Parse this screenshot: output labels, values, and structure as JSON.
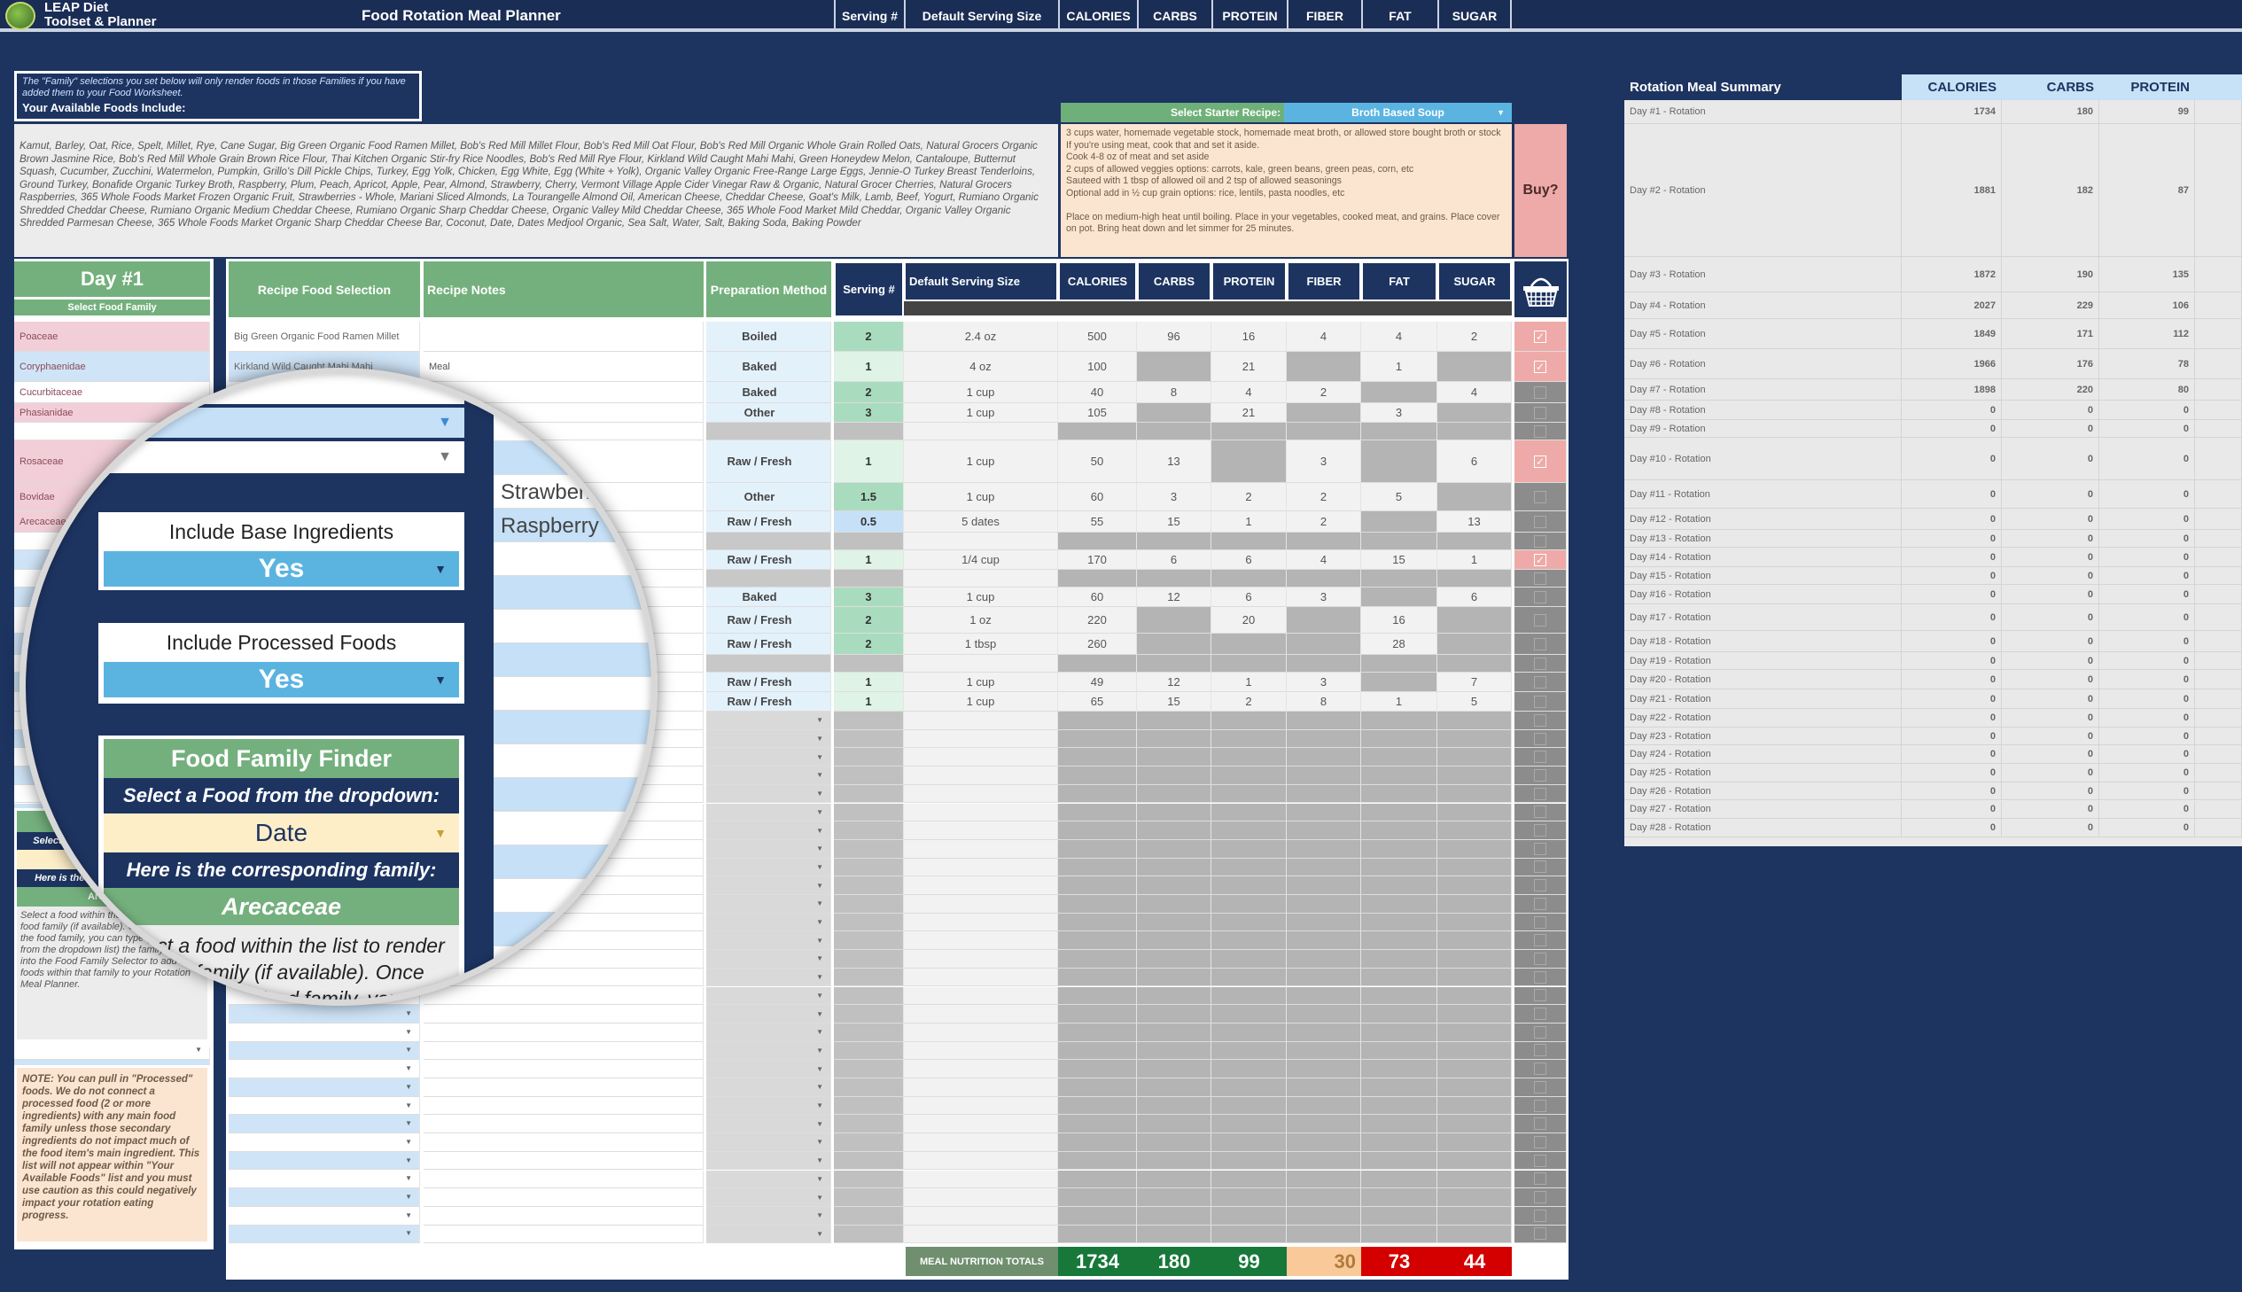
{
  "app": {
    "logo_line1": "LEAP Diet",
    "logo_line2": "Toolset & Planner",
    "title": "Food Rotation Meal Planner"
  },
  "top_columns": [
    "Serving #",
    "Default Serving Size",
    "CALORIES",
    "CARBS",
    "PROTEIN",
    "FIBER",
    "FAT",
    "SUGAR"
  ],
  "info": {
    "note": "The \"Family\" selections you set below will only render foods in those Families if you have added them to your Food Worksheet.",
    "heading": "Your Available Foods Include:",
    "foods": "Kamut, Barley, Oat, Rice, Spelt, Millet, Rye, Cane Sugar, Big Green Organic Food Ramen Millet, Bob's Red Mill Millet Flour, Bob's Red Mill Oat Flour, Bob's Red Mill Organic Whole Grain Rolled Oats, Natural Grocers Organic Brown Jasmine Rice, Bob's Red Mill Whole Grain Brown Rice Flour, Thai Kitchen Organic Stir-fry Rice Noodles, Bob's Red Mill Rye Flour, Kirkland Wild Caught Mahi Mahi, Green Honeydew Melon, Cantaloupe, Butternut Squash, Cucumber, Zucchini, Watermelon, Pumpkin, Grillo's Dill Pickle Chips, Turkey, Egg Yolk, Chicken, Egg White, Egg (White + Yolk), Organic Valley Organic Free-Range Large Eggs, Jennie-O Turkey Breast Tenderloins, Ground Turkey, Bonafide Organic Turkey Broth, Raspberry, Plum, Peach, Apricot, Apple, Pear, Almond, Strawberry, Cherry, Vermont Village Apple Cider Vinegar Raw & Organic, Natural Grocer Cherries, Natural Grocers Raspberries, 365 Whole Foods Market Frozen Organic Fruit, Strawberries - Whole, Mariani Sliced Almonds, La Tourangelle Almond Oil, American Cheese, Cheddar Cheese, Goat's Milk, Lamb, Beef, Yogurt, Rumiano Organic Shredded Cheddar Cheese, Rumiano Organic Medium Cheddar Cheese, Rumiano Organic Sharp Cheddar Cheese, Organic Valley Mild Cheddar Cheese, 365 Whole Food Market Mild Cheddar, Organic Valley Organic Shredded Parmesan Cheese, 365 Whole Foods Market Organic Sharp Cheddar Cheese Bar, Coconut, Date, Dates Medjool Organic, Sea Salt, Water, Salt, Baking Soda, Baking Powder"
  },
  "recipe": {
    "select_label": "Select Starter Recipe:",
    "selected": "Broth Based Soup",
    "text": "3 cups water, homemade vegetable stock, homemade meat broth, or allowed store bought broth or stock\nIf you're using meat, cook that and set it aside.\nCook 4-8 oz of meat and set aside\n2 cups of allowed veggies options: carrots, kale, green beans, green peas, corn, etc\nSauteed with 1 tbsp of allowed oil and 2 tsp of allowed seasonings\nOptional add in ½ cup grain options: rice, lentils, pasta noodles, etc\n\nPlace on medium-high heat until boiling. Place in your vegetables, cooked meat, and grains. Place cover on pot. Bring heat down and let simmer for 25 minutes.",
    "buy_label": "Buy?"
  },
  "table": {
    "day_title": "Day #1",
    "family_header": "Select Food Family",
    "headers": {
      "food": "Recipe Food Selection",
      "notes": "Recipe Notes",
      "prep": "Preparation Method",
      "serving": "Serving #",
      "size": "Default Serving Size",
      "nutrients": [
        "CALORIES",
        "CARBS",
        "PROTEIN",
        "FIBER",
        "FAT",
        "SUGAR"
      ]
    },
    "basket_icon": "shopping-basket-icon",
    "rows": [
      {
        "family": "Poaceae",
        "family_color": "#f2cfd8",
        "food": "Big Green Organic Food Ramen Millet",
        "notes": "",
        "prep": "Boiled",
        "serving": "2",
        "size": "2.4 oz",
        "values": [
          500,
          96,
          16,
          4,
          4,
          2
        ],
        "buy": true
      },
      {
        "family": "Coryphaenidae",
        "family_color": "#cfe4f7",
        "food": "Kirkland Wild Caught Mahi Mahi",
        "notes": "Meal",
        "prep": "Baked",
        "serving": "1",
        "size": "4 oz",
        "values": [
          100,
          null,
          21,
          null,
          1,
          null
        ],
        "buy": true
      },
      {
        "family": "Cucurbitaceae",
        "family_color": "#ffffff",
        "food": "",
        "notes": "",
        "prep": "Baked",
        "serving": "2",
        "size": "1 cup",
        "values": [
          40,
          8,
          4,
          2,
          null,
          4
        ],
        "buy": false
      },
      {
        "family": "Phasianidae",
        "family_color": "#f2cfd8",
        "food": "",
        "notes": "",
        "prep": "Other",
        "serving": "3",
        "size": "1 cup",
        "values": [
          105,
          null,
          21,
          null,
          3,
          null
        ],
        "buy": false
      },
      {
        "family": "",
        "family_color": "#ffffff",
        "food": "",
        "notes": "",
        "prep": "",
        "serving": "",
        "size": "",
        "values": [
          null,
          null,
          null,
          null,
          null,
          null
        ],
        "buy": false
      },
      {
        "family": "Rosaceae",
        "family_color": "#f2cfd8",
        "food": "",
        "notes": "",
        "prep": "Raw / Fresh",
        "serving": "1",
        "size": "1 cup",
        "values": [
          50,
          13,
          null,
          3,
          null,
          6
        ],
        "buy": true
      },
      {
        "family": "Bovidae",
        "family_color": "#f2cfd8",
        "food": "",
        "notes": "Strawberry",
        "prep": "Other",
        "serving": "1.5",
        "size": "1 cup",
        "values": [
          60,
          3,
          2,
          2,
          5,
          null
        ],
        "buy": false
      },
      {
        "family": "Arecaceae",
        "family_color": "#f2cfd8",
        "food": "",
        "notes": "Raspberry",
        "prep": "Raw / Fresh",
        "serving": "0.5",
        "size": "5 dates",
        "values": [
          55,
          15,
          1,
          2,
          null,
          13
        ],
        "buy": false
      },
      {
        "family": "",
        "family_color": "#ffffff",
        "food": "",
        "notes": "",
        "prep": "",
        "serving": "",
        "size": "",
        "values": [
          null,
          null,
          null,
          null,
          null,
          null
        ],
        "buy": false
      },
      {
        "family": "",
        "family_color": "#cfe4f7",
        "food": "",
        "notes": "",
        "prep": "Raw / Fresh",
        "serving": "1",
        "size": "1/4 cup",
        "values": [
          170,
          6,
          6,
          4,
          15,
          1
        ],
        "buy": true
      },
      {
        "family": "",
        "family_color": "#ffffff",
        "food": "",
        "notes": "",
        "prep": "",
        "serving": "",
        "size": "",
        "values": [
          null,
          null,
          null,
          null,
          null,
          null
        ],
        "buy": false
      },
      {
        "family": "",
        "family_color": "#cfe4f7",
        "food": "",
        "notes": "",
        "prep": "Baked",
        "serving": "3",
        "size": "1 cup",
        "values": [
          60,
          12,
          6,
          3,
          null,
          6
        ],
        "buy": false
      },
      {
        "family": "",
        "family_color": "#ffffff",
        "food": "",
        "notes": "",
        "prep": "Raw / Fresh",
        "serving": "2",
        "size": "1 oz",
        "values": [
          220,
          null,
          20,
          null,
          16,
          null
        ],
        "buy": false
      },
      {
        "family": "",
        "family_color": "#cfe4f7",
        "food": "",
        "notes": "",
        "prep": "Raw / Fresh",
        "serving": "2",
        "size": "1 tbsp",
        "values": [
          260,
          null,
          null,
          null,
          28,
          null
        ],
        "buy": false
      },
      {
        "family": "",
        "family_color": "#ffffff",
        "food": "",
        "notes": "",
        "prep": "",
        "serving": "",
        "size": "",
        "values": [
          null,
          null,
          null,
          null,
          null,
          null
        ],
        "buy": false
      },
      {
        "family": "",
        "family_color": "#cfe4f7",
        "food": "",
        "notes": "",
        "prep": "Raw / Fresh",
        "serving": "1",
        "size": "1 cup",
        "values": [
          49,
          12,
          1,
          3,
          null,
          7
        ],
        "buy": false
      },
      {
        "family": "",
        "family_color": "#ffffff",
        "food": "",
        "notes": "",
        "prep": "Raw / Fresh",
        "serving": "1",
        "size": "1 cup",
        "values": [
          65,
          15,
          2,
          8,
          1,
          5
        ],
        "buy": false
      }
    ],
    "totals": {
      "label": "MEAL NUTRITION TOTALS",
      "values": [
        1734,
        180,
        99,
        30,
        73,
        44
      ],
      "colors": [
        "#17783a",
        "#17783a",
        "#17783a",
        "#f9c99a",
        "#d40000",
        "#d40000"
      ]
    }
  },
  "sidebar": {
    "include_base": {
      "label": "Include Base Ingredients",
      "value": "Yes"
    },
    "include_processed": {
      "label": "Include Processed Foods",
      "value": "Yes"
    },
    "finder": {
      "title": "Food Family Finder",
      "prompt": "Select a Food from the dropdown:",
      "selected_food": "Date",
      "result_label": "Here is the corresponding family:",
      "result": "Arecaceae",
      "help": "Select a food within the list to render the food family (if available). Once you identify the food family, you can type (or select from the dropdown list) the family name into the Food Family Selector to add all foods within that family to your Rotation Meal Planner."
    },
    "note": "NOTE: You can pull in \"Processed\" foods. We do not connect a processed food (2 or more ingredients) with any main food family unless those secondary ingredients do not impact much of the food item's main ingredient. This list will not appear within \"Your Available Foods\" list and you must use caution as this could negatively impact your rotation eating progress."
  },
  "summary": {
    "title": "Rotation Meal Summary",
    "columns": [
      "CALORIES",
      "CARBS",
      "PROTEIN"
    ],
    "rows": [
      [
        "Day #1 - Rotation",
        1734,
        180,
        99
      ],
      [
        "Day #2 - Rotation",
        1881,
        182,
        87
      ],
      [
        "Day #3 - Rotation",
        1872,
        190,
        135
      ],
      [
        "Day #4 - Rotation",
        2027,
        229,
        106
      ],
      [
        "Day #5 - Rotation",
        1849,
        171,
        112
      ],
      [
        "Day #6 - Rotation",
        1966,
        176,
        78
      ],
      [
        "Day #7 - Rotation",
        1898,
        220,
        80
      ],
      [
        "Day #8 - Rotation",
        0,
        0,
        0
      ],
      [
        "Day #9 - Rotation",
        0,
        0,
        0
      ],
      [
        "Day #10 - Rotation",
        0,
        0,
        0
      ],
      [
        "Day #11 - Rotation",
        0,
        0,
        0
      ],
      [
        "Day #12 - Rotation",
        0,
        0,
        0
      ],
      [
        "Day #13 - Rotation",
        0,
        0,
        0
      ],
      [
        "Day #14 - Rotation",
        0,
        0,
        0
      ],
      [
        "Day #15 - Rotation",
        0,
        0,
        0
      ],
      [
        "Day #16 - Rotation",
        0,
        0,
        0
      ],
      [
        "Day #17 - Rotation",
        0,
        0,
        0
      ],
      [
        "Day #18 - Rotation",
        0,
        0,
        0
      ],
      [
        "Day #19 - Rotation",
        0,
        0,
        0
      ],
      [
        "Day #20 - Rotation",
        0,
        0,
        0
      ],
      [
        "Day #21 - Rotation",
        0,
        0,
        0
      ],
      [
        "Day #22 - Rotation",
        0,
        0,
        0
      ],
      [
        "Day #23 - Rotation",
        0,
        0,
        0
      ],
      [
        "Day #24 - Rotation",
        0,
        0,
        0
      ],
      [
        "Day #25 - Rotation",
        0,
        0,
        0
      ],
      [
        "Day #26 - Rotation",
        0,
        0,
        0
      ],
      [
        "Day #27 - Rotation",
        0,
        0,
        0
      ],
      [
        "Day #28 - Rotation",
        0,
        0,
        0
      ]
    ]
  }
}
